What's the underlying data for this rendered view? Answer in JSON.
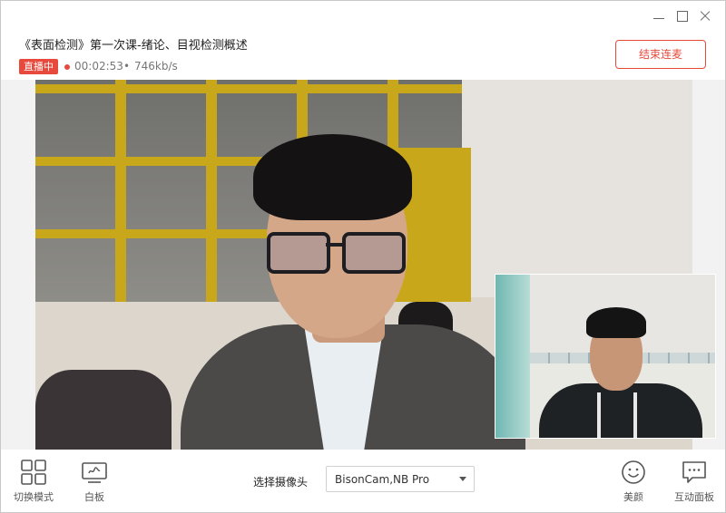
{
  "header": {
    "course_title": "《表面检测》第一次课-绪论、目视检测概述",
    "live_badge": "直播中",
    "elapsed_time": "00:02:53",
    "separator": "•",
    "bitrate": "746kb/s",
    "end_button": "结束连麦"
  },
  "toolbar": {
    "switch_mode": {
      "label": "切换模式",
      "icon": "grid-layout-icon"
    },
    "whiteboard": {
      "label": "白板",
      "icon": "whiteboard-icon"
    },
    "camera_label": "选择摄像头",
    "camera_selected": "BisonCam,NB Pro",
    "beauty": {
      "label": "美颜",
      "icon": "smiley-icon"
    },
    "interaction_panel": {
      "label": "互动面板",
      "icon": "chat-bubble-icon"
    }
  },
  "colors": {
    "accent_red": "#e8493d",
    "window_frame": "#c9a71a"
  }
}
